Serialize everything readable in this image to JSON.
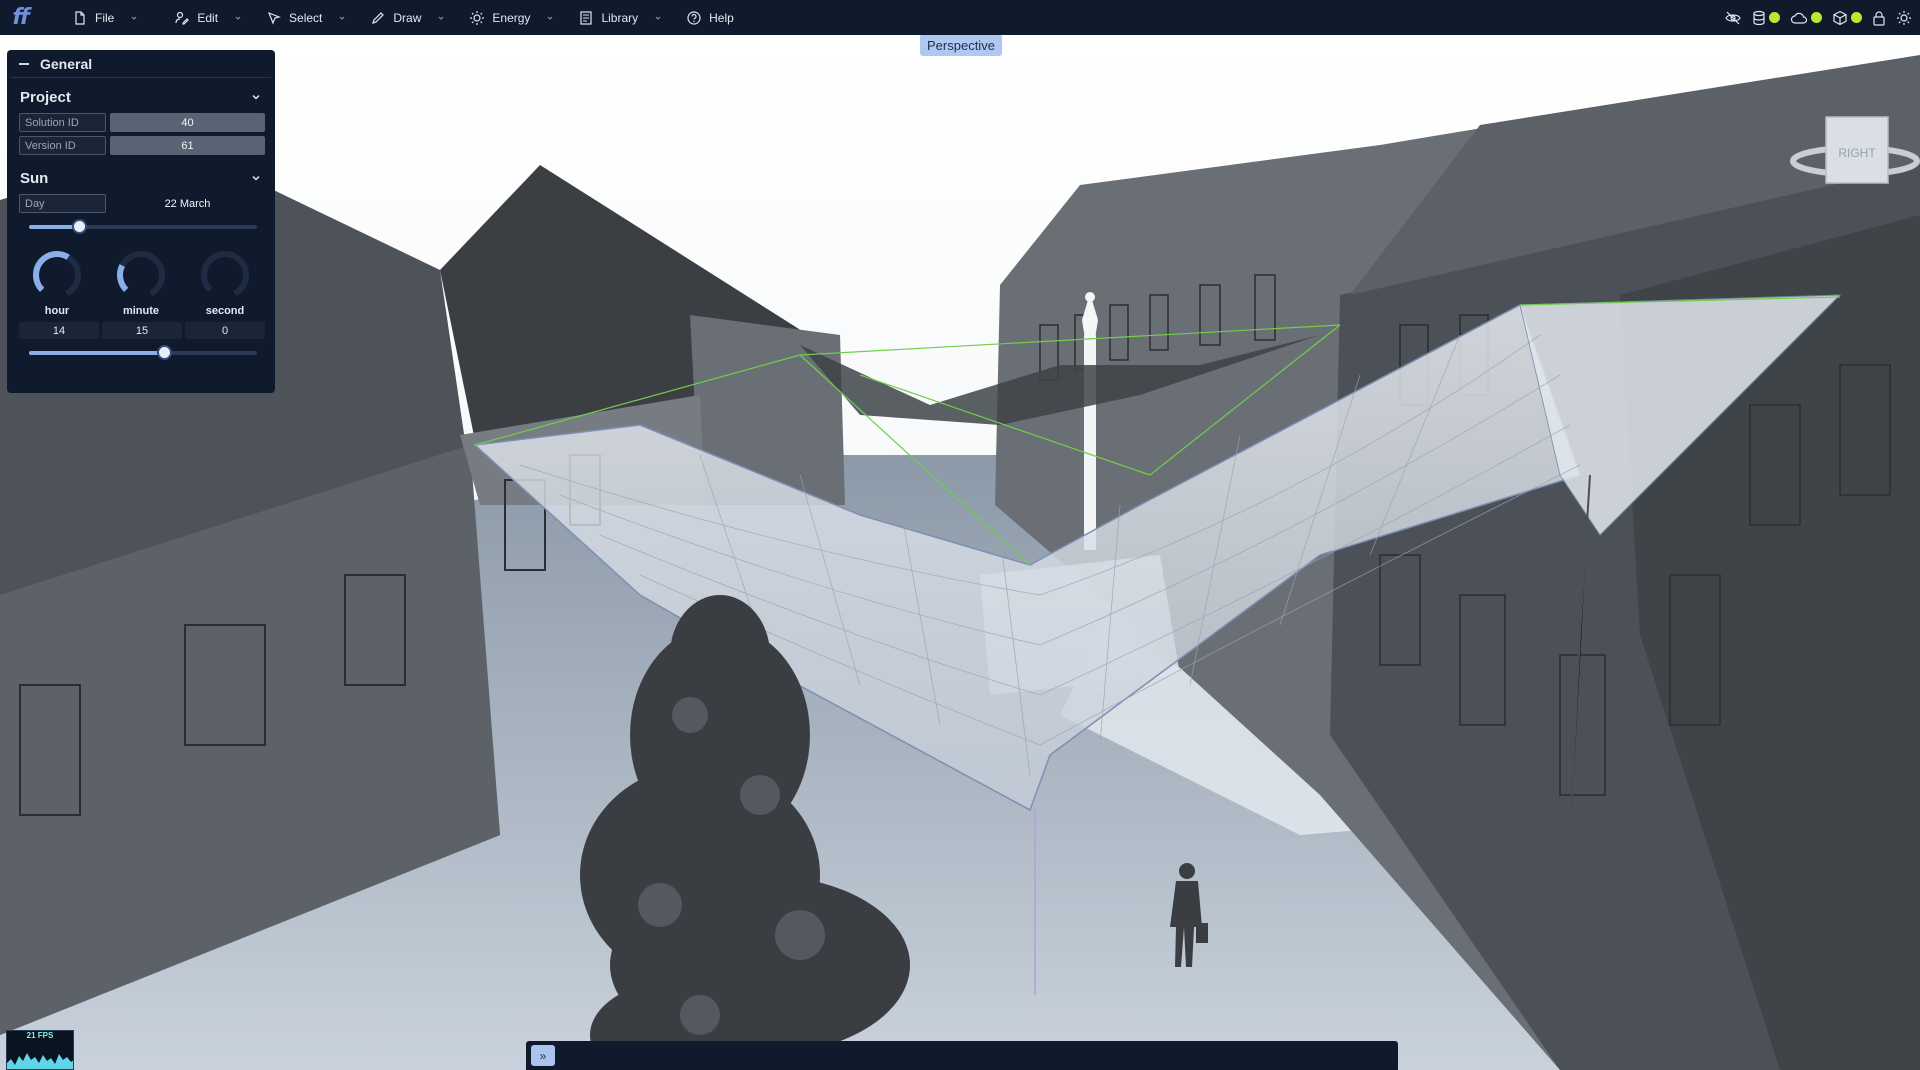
{
  "app": {
    "logo": "ff"
  },
  "menu": [
    {
      "label": "File",
      "icon": "file-icon"
    },
    {
      "label": "Edit",
      "icon": "edit-icon"
    },
    {
      "label": "Select",
      "icon": "cursor-icon"
    },
    {
      "label": "Draw",
      "icon": "pen-icon"
    },
    {
      "label": "Energy",
      "icon": "sun-icon"
    },
    {
      "label": "Library",
      "icon": "book-icon"
    },
    {
      "label": "Help",
      "icon": "help-icon"
    }
  ],
  "toolbar_right": {
    "icons": [
      "eye-off-icon",
      "database-icon",
      "cloud-icon",
      "cube-icon",
      "lock-icon",
      "settings-sun-icon"
    ],
    "status_color": "#b9e835"
  },
  "viewport": {
    "view_mode": "Perspective",
    "navcube_face": "RIGHT"
  },
  "panel": {
    "title": "General",
    "project": {
      "title": "Project",
      "solution_label": "Solution ID",
      "solution_value": "40",
      "version_label": "Version ID",
      "version_value": "61"
    },
    "sun": {
      "title": "Sun",
      "day_label": "Day",
      "day_value": "22 March",
      "day_slider_fraction": 0.22,
      "hour_label": "hour",
      "minute_label": "minute",
      "second_label": "second",
      "hour": "14",
      "minute": "15",
      "second": "0",
      "time_slider_fraction": 0.59
    }
  },
  "fps": {
    "label": "21 FPS"
  },
  "bottombar": {
    "expand_icon": "double-chevron-right-icon",
    "expand_glyph": "»"
  }
}
